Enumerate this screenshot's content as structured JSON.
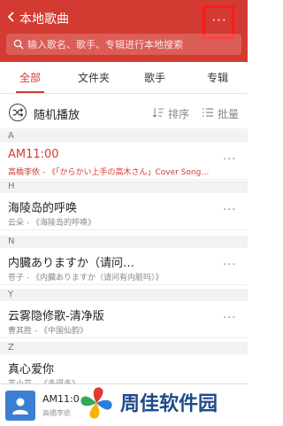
{
  "header": {
    "title": "本地歌曲",
    "more_label": "···"
  },
  "search": {
    "placeholder": "输入歌名、歌手、专辑进行本地搜索"
  },
  "tabs": [
    {
      "label": "全部",
      "active": true
    },
    {
      "label": "文件夹",
      "active": false
    },
    {
      "label": "歌手",
      "active": false
    },
    {
      "label": "专辑",
      "active": false
    }
  ],
  "toolbar": {
    "shuffle_label": "随机播放",
    "sort_label": "排序",
    "manage_label": "批量"
  },
  "sections": [
    {
      "letter": "A",
      "songs": [
        {
          "name": "AM11:00",
          "artist": "高橋李依 - 《「からかい上手の高木さん」Cover Song…",
          "playing": true
        }
      ]
    },
    {
      "letter": "H",
      "songs": [
        {
          "name": "海陵岛的呼唤",
          "artist": "云朵 - 《海陵岛的呼唤》",
          "playing": false
        }
      ]
    },
    {
      "letter": "N",
      "songs": [
        {
          "name": "内臓ありますか（请问…",
          "artist": "苍子 - 《内臓ありますか（请问有内脏吗）》",
          "playing": false
        }
      ]
    },
    {
      "letter": "Y",
      "songs": [
        {
          "name": "云雾隐修歌-清净版",
          "artist": "曹其胜 - 《中国仙韵》",
          "playing": false
        }
      ]
    },
    {
      "letter": "Z",
      "songs": [
        {
          "name": "真心爱你",
          "artist": "苏小花 - 《多得多》",
          "playing": false
        }
      ]
    }
  ],
  "song_more_label": "···",
  "player": {
    "title": "AM11:0",
    "artist": "高橋李依"
  },
  "watermark": {
    "text": "周佳软件园"
  },
  "colors": {
    "accent": "#d33a31",
    "highlight_box": "#ff1a1a"
  }
}
